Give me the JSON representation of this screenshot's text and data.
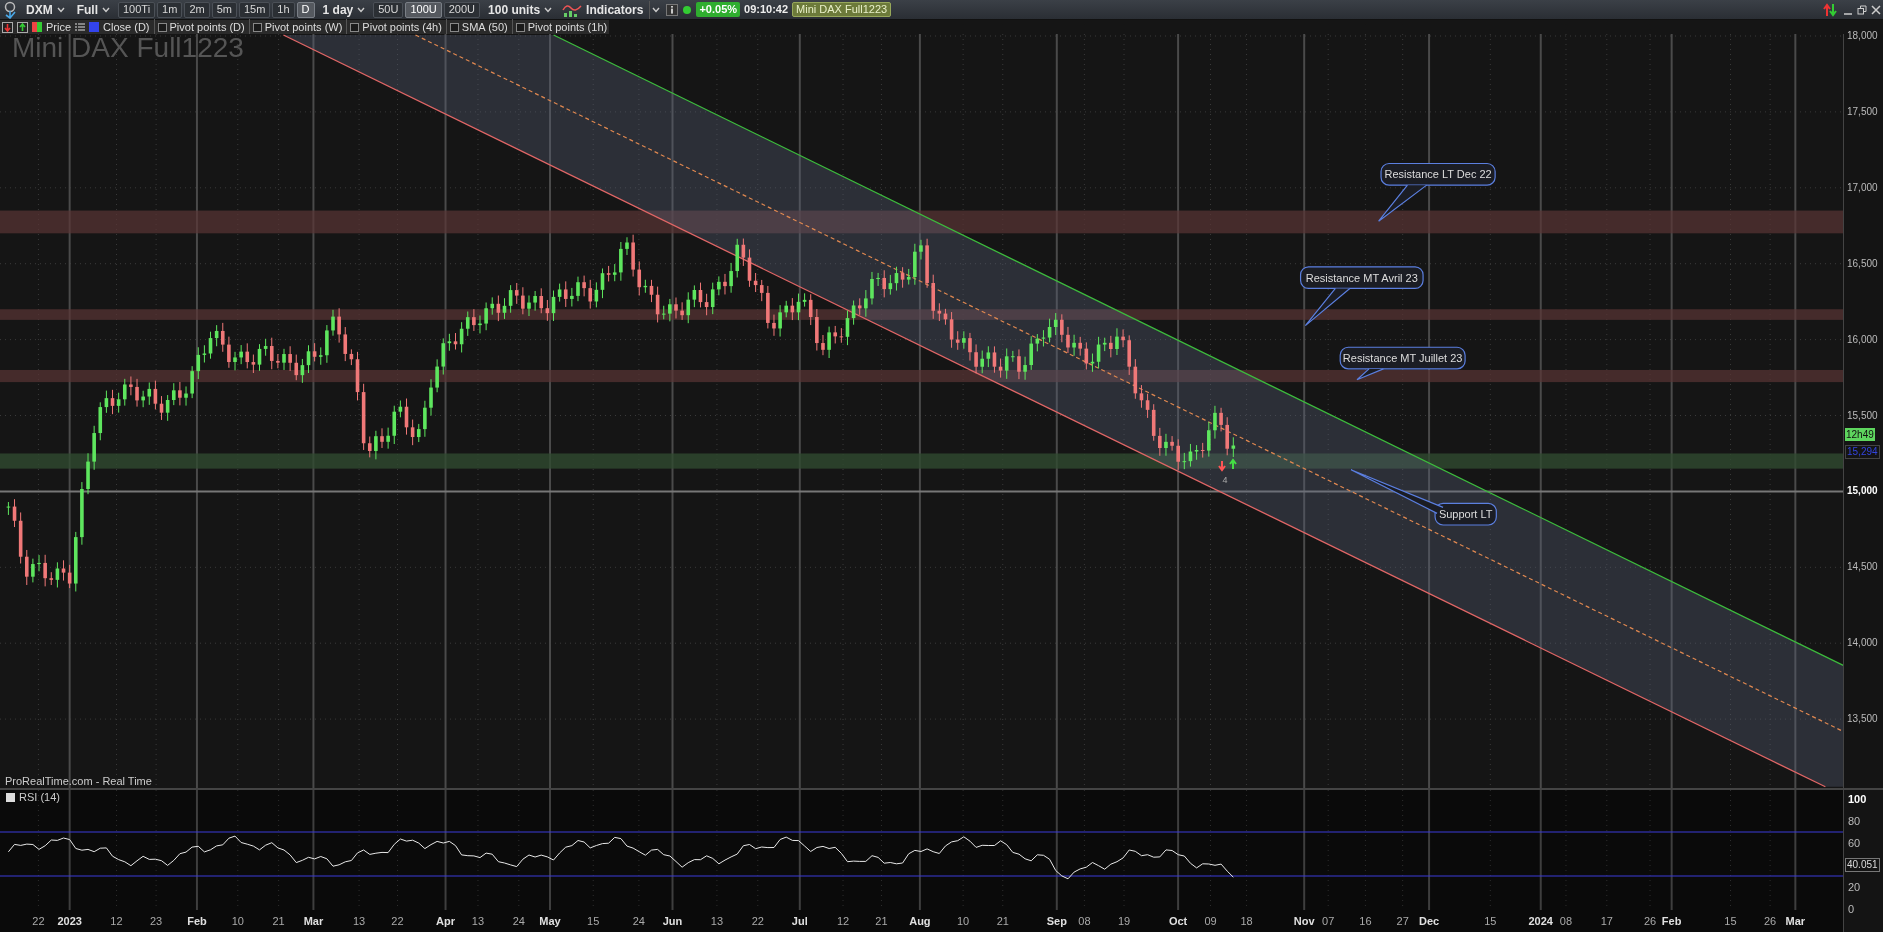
{
  "toolbar": {
    "symbol": "DXM",
    "view": "Full",
    "intervals": [
      {
        "label": "100Ti",
        "selected": false
      },
      {
        "label": "1m",
        "selected": false
      },
      {
        "label": "2m",
        "selected": false
      },
      {
        "label": "5m",
        "selected": false
      },
      {
        "label": "15m",
        "selected": false
      },
      {
        "label": "1h",
        "selected": false
      },
      {
        "label": "D",
        "selected": true
      }
    ],
    "period": "1 day",
    "unit_buttons": [
      {
        "label": "50U",
        "selected": false
      },
      {
        "label": "100U",
        "selected": true
      },
      {
        "label": "200U",
        "selected": false
      }
    ],
    "units": "100 units",
    "indicators": "Indicators",
    "change": "+0.05%",
    "time": "09:10:42",
    "instrument": "Mini DAX Full1223"
  },
  "legend": {
    "price": "Price",
    "close": "Close (D)",
    "options": [
      {
        "label": "Pivot points (D)",
        "checked": false
      },
      {
        "label": "Pivot points (W)",
        "checked": false
      },
      {
        "label": "Pivot points (4h)",
        "checked": false
      },
      {
        "label": "SMA (50)",
        "checked": false
      },
      {
        "label": "Pivot points (1h)",
        "checked": false
      }
    ]
  },
  "chart": {
    "title": "Mini DAX Full1223",
    "source": "ProRealTime.com - Real Time",
    "signal_count": "4",
    "countdown": "12h49",
    "last_price": "15,294",
    "price_axis": [
      {
        "label": "18,000",
        "highlighted": false
      },
      {
        "label": "17,500",
        "highlighted": false
      },
      {
        "label": "17,000",
        "highlighted": false
      },
      {
        "label": "16,500",
        "highlighted": false
      },
      {
        "label": "16,000",
        "highlighted": false
      },
      {
        "label": "15,500",
        "highlighted": false
      },
      {
        "label": "15,000",
        "highlighted": true
      },
      {
        "label": "14,500",
        "highlighted": false
      },
      {
        "label": "14,000",
        "highlighted": false
      },
      {
        "label": "13,500",
        "highlighted": false
      }
    ],
    "annotations": [
      {
        "label": "Resistance LT Dec 22"
      },
      {
        "label": "Resistance MT Avril 23"
      },
      {
        "label": "Resistance MT Juillet 23"
      },
      {
        "label": "Support LT"
      }
    ]
  },
  "rsi": {
    "title": "RSI (14)",
    "axis": [
      "100",
      "80",
      "60",
      "20",
      "0"
    ],
    "reading": "40.051"
  },
  "time_axis": [
    {
      "label": "22",
      "major": false
    },
    {
      "label": "2023",
      "major": true
    },
    {
      "label": "12",
      "major": false
    },
    {
      "label": "23",
      "major": false
    },
    {
      "label": "Feb",
      "major": true
    },
    {
      "label": "10",
      "major": false
    },
    {
      "label": "21",
      "major": false
    },
    {
      "label": "Mar",
      "major": true
    },
    {
      "label": "13",
      "major": false
    },
    {
      "label": "22",
      "major": false
    },
    {
      "label": "Apr",
      "major": true
    },
    {
      "label": "13",
      "major": false
    },
    {
      "label": "24",
      "major": false
    },
    {
      "label": "May",
      "major": true
    },
    {
      "label": "15",
      "major": false
    },
    {
      "label": "24",
      "major": false
    },
    {
      "label": "Jun",
      "major": true
    },
    {
      "label": "13",
      "major": false
    },
    {
      "label": "22",
      "major": false
    },
    {
      "label": "Jul",
      "major": true
    },
    {
      "label": "12",
      "major": false
    },
    {
      "label": "21",
      "major": false
    },
    {
      "label": "Aug",
      "major": true
    },
    {
      "label": "10",
      "major": false
    },
    {
      "label": "21",
      "major": false
    },
    {
      "label": "Sep",
      "major": true
    },
    {
      "label": "08",
      "major": false
    },
    {
      "label": "19",
      "major": false
    },
    {
      "label": "Oct",
      "major": true
    },
    {
      "label": "09",
      "major": false
    },
    {
      "label": "18",
      "major": false
    },
    {
      "label": "Nov",
      "major": true
    },
    {
      "label": "07",
      "major": false
    },
    {
      "label": "16",
      "major": false
    },
    {
      "label": "27",
      "major": false
    },
    {
      "label": "Dec",
      "major": true
    },
    {
      "label": "15",
      "major": false
    },
    {
      "label": "2024",
      "major": true
    },
    {
      "label": "08",
      "major": false
    },
    {
      "label": "17",
      "major": false
    },
    {
      "label": "26",
      "major": false
    },
    {
      "label": "Feb",
      "major": true
    },
    {
      "label": "15",
      "major": false
    },
    {
      "label": "26",
      "major": false
    },
    {
      "label": "Mar",
      "major": true
    }
  ]
}
